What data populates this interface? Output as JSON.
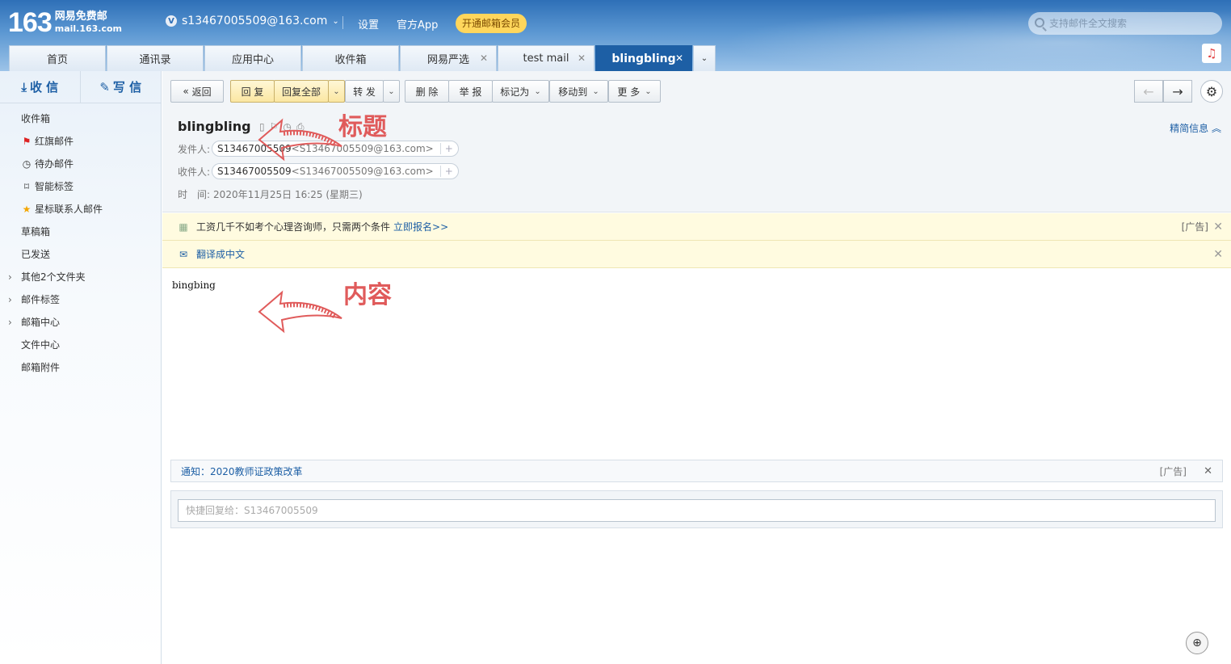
{
  "header": {
    "logo_num": "163",
    "logo_line1": "网易免费邮",
    "logo_line2": "mail.163.com",
    "account": "s13467005509@163.com",
    "settings": "设置",
    "app": "官方App",
    "vip": "开通邮箱会员",
    "search_placeholder": "支持邮件全文搜索"
  },
  "tabs": [
    {
      "label": "首页"
    },
    {
      "label": "通讯录"
    },
    {
      "label": "应用中心"
    },
    {
      "label": "收件箱"
    },
    {
      "label": "网易严选"
    },
    {
      "label": "test mail"
    },
    {
      "label": "blingbling"
    }
  ],
  "sidebar": {
    "receive": "收 信",
    "compose": "写 信",
    "items": [
      {
        "label": "收件箱"
      },
      {
        "label": "红旗邮件"
      },
      {
        "label": "待办邮件"
      },
      {
        "label": "智能标签"
      },
      {
        "label": "星标联系人邮件"
      },
      {
        "label": "草稿箱"
      },
      {
        "label": "已发送"
      },
      {
        "label": "其他2个文件夹"
      },
      {
        "label": "邮件标签"
      },
      {
        "label": "邮箱中心"
      },
      {
        "label": "文件中心"
      },
      {
        "label": "邮箱附件"
      }
    ]
  },
  "toolbar": {
    "back": "返回",
    "reply": "回 复",
    "reply_all": "回复全部",
    "forward": "转 发",
    "delete": "删 除",
    "report": "举 报",
    "mark_as": "标记为",
    "move_to": "移动到",
    "more": "更 多"
  },
  "mail": {
    "subject": "blingbling",
    "brief_info": "精简信息",
    "sender_label": "发件人:",
    "sender_name": "S13467005509",
    "sender_email": "<S13467005509@163.com>",
    "recipient_label": "收件人:",
    "recipient_name": "S13467005509",
    "recipient_email": "<S13467005509@163.com>",
    "time_label": "时　间:",
    "time_value": "2020年11月25日 16:25 (星期三)",
    "body": "bingbing"
  },
  "ad1": {
    "text": "工资几千不如考个心理咨询师，只需两个条件",
    "link": "立即报名>>",
    "tag": "[广告]"
  },
  "translate": {
    "text": "翻译成中文"
  },
  "annotations": {
    "title": "标题",
    "content": "内容"
  },
  "notice": {
    "text": "通知：2020教师证政策改革",
    "tag": "[广告]"
  },
  "quick_reply": {
    "placeholder": "快捷回复给：S13467005509"
  },
  "colors": {
    "header_blue": "#2e6fb7",
    "active_tab": "#1d5fa5",
    "annotation_red": "#e05b5b",
    "vip_yellow": "#ffd65c"
  }
}
